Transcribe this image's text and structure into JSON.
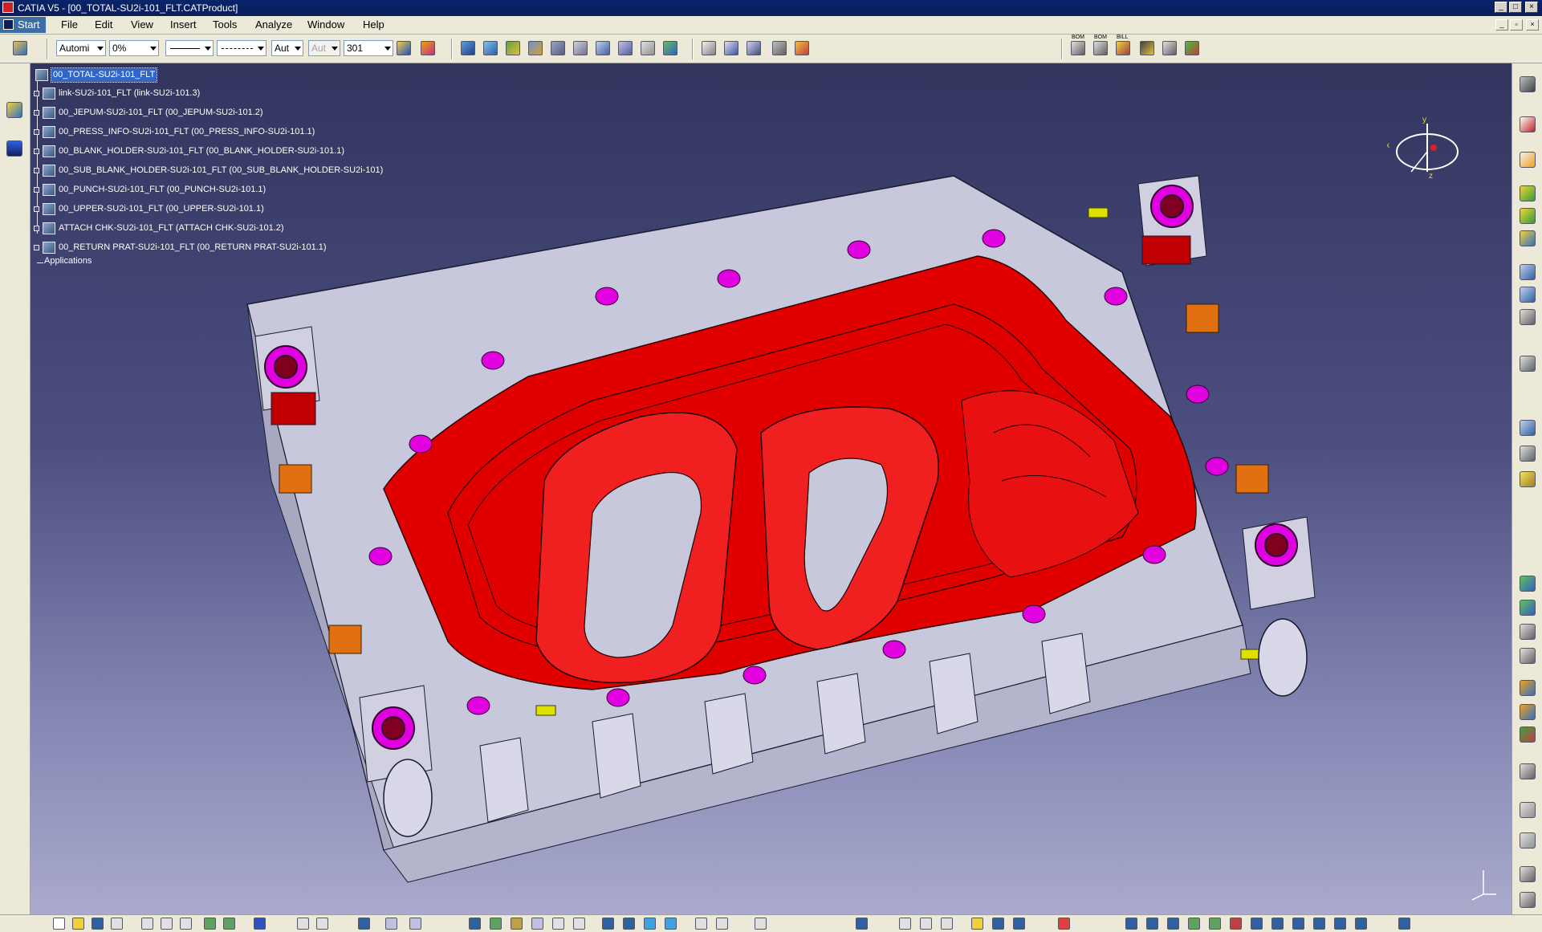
{
  "window": {
    "title": "CATIA V5 - [00_TOTAL-SU2i-101_FLT.CATProduct]",
    "min_glyph": "_",
    "max_glyph": "□",
    "close_glyph": "×"
  },
  "menu": {
    "start": "Start",
    "items": [
      "File",
      "Edit",
      "View",
      "Insert",
      "Tools",
      "Analyze",
      "Window",
      "Help"
    ]
  },
  "toolbar": {
    "transparency_combo": "Automi",
    "percent_combo": "0%",
    "weight_combo": "Aut",
    "layer_combo": "Aut",
    "number_combo": "301",
    "text_labels": [
      "BOM",
      "BOM",
      "BILL"
    ]
  },
  "tree": {
    "root": "00_TOTAL-SU2i-101_FLT",
    "children": [
      "link-SU2i-101_FLT (link-SU2i-101.3)",
      "00_JEPUM-SU2i-101_FLT (00_JEPUM-SU2i-101.2)",
      "00_PRESS_INFO-SU2i-101_FLT (00_PRESS_INFO-SU2i-101.1)",
      "00_BLANK_HOLDER-SU2i-101_FLT (00_BLANK_HOLDER-SU2i-101.1)",
      "00_SUB_BLANK_HOLDER-SU2i-101_FLT (00_SUB_BLANK_HOLDER-SU2i-101)",
      "00_PUNCH-SU2i-101_FLT (00_PUNCH-SU2i-101.1)",
      "00_UPPER-SU2i-101_FLT (00_UPPER-SU2i-101.1)",
      "ATTACH CHK-SU2i-101_FLT (ATTACH CHK-SU2i-101.2)",
      "00_RETURN PRAT-SU2i-101_FLT (00_RETURN PRAT-SU2i-101.1)"
    ],
    "applications": "Applications"
  },
  "compass": {
    "x_label": "x",
    "y_label": "y",
    "z_label": "z"
  },
  "colors": {
    "part_red": "#e00000",
    "die_gray": "#c8c8dc",
    "pad_magenta": "#e000e0",
    "pad_orange": "#e07010",
    "bolt_yellow": "#e0e000",
    "viewport_top": "#32355e",
    "viewport_bottom": "#a9aacb"
  },
  "icons": {
    "left_bar": [
      "product-structure-icon",
      "plane-icon"
    ],
    "right_bar": [
      "steering-icon",
      "pdf-icon",
      "select-icon",
      "insert-component-icon",
      "existing-component-icon",
      "new-product-icon",
      "new-part-icon",
      "replace-icon",
      "graph-tree-icon",
      "multi-instance-icon",
      "fast-multi-instance-icon",
      "reorder-icon",
      "numbering-icon",
      "snap-icon",
      "smart-move-icon",
      "explode-icon",
      "manipulation-icon",
      "coincidence-icon",
      "contact-icon",
      "offset-icon",
      "angle-icon",
      "fix-icon",
      "fix-together-icon",
      "quick-constraint-icon",
      "update-icon",
      "catalog-icon"
    ]
  }
}
